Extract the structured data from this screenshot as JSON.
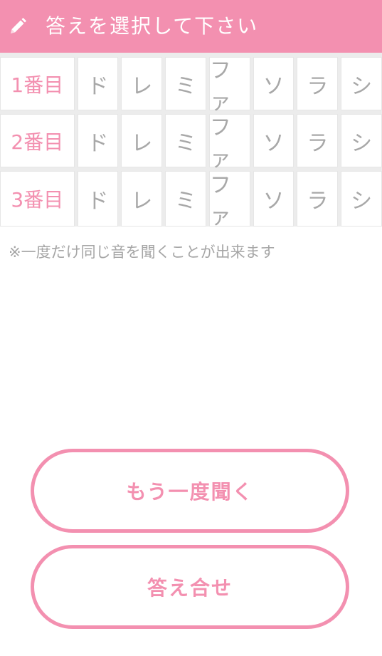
{
  "header": {
    "title": "答えを選択して下さい",
    "icon": "pencil-icon"
  },
  "grid": {
    "rows": [
      {
        "label": "1番目",
        "notes": [
          "ド",
          "レ",
          "ミ",
          "ファ",
          "ソ",
          "ラ",
          "シ"
        ]
      },
      {
        "label": "2番目",
        "notes": [
          "ド",
          "レ",
          "ミ",
          "ファ",
          "ソ",
          "ラ",
          "シ"
        ]
      },
      {
        "label": "3番目",
        "notes": [
          "ド",
          "レ",
          "ミ",
          "ファ",
          "ソ",
          "ラ",
          "シ"
        ]
      }
    ]
  },
  "hint": "※一度だけ同じ音を聞くことが出来ます",
  "buttons": {
    "replay_label": "もう一度聞く",
    "check_label": "答え合せ"
  },
  "colors": {
    "accent": "#f390b0",
    "note_text": "#a8a8a8",
    "hint_text": "#a6a6a6",
    "grid_bg": "#ececec"
  }
}
